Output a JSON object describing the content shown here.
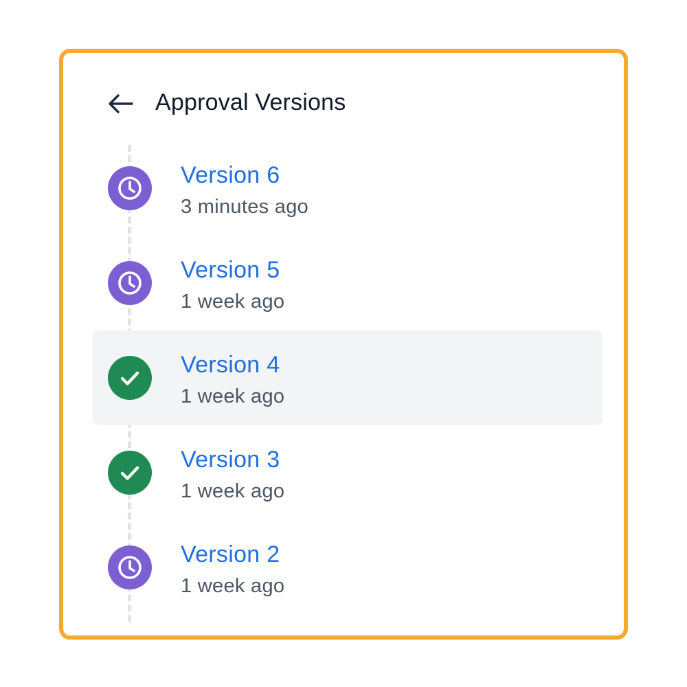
{
  "header": {
    "back_icon": "arrow-left-icon",
    "title": "Approval Versions"
  },
  "colors": {
    "border_accent": "#f6a92c",
    "pending": "#7c5fd3",
    "approved": "#1f8a53",
    "link": "#1f6fe0",
    "selected_bg": "#f3f4f6"
  },
  "versions": [
    {
      "label": "Version 6",
      "time": "3 minutes ago",
      "status": "pending",
      "icon": "clock-icon",
      "selected": false
    },
    {
      "label": "Version 5",
      "time": "1 week ago",
      "status": "pending",
      "icon": "clock-icon",
      "selected": false
    },
    {
      "label": "Version 4",
      "time": "1 week ago",
      "status": "approved",
      "icon": "check-icon",
      "selected": true
    },
    {
      "label": "Version 3",
      "time": "1 week ago",
      "status": "approved",
      "icon": "check-icon",
      "selected": false
    },
    {
      "label": "Version 2",
      "time": "1 week ago",
      "status": "pending",
      "icon": "clock-icon",
      "selected": false
    }
  ]
}
